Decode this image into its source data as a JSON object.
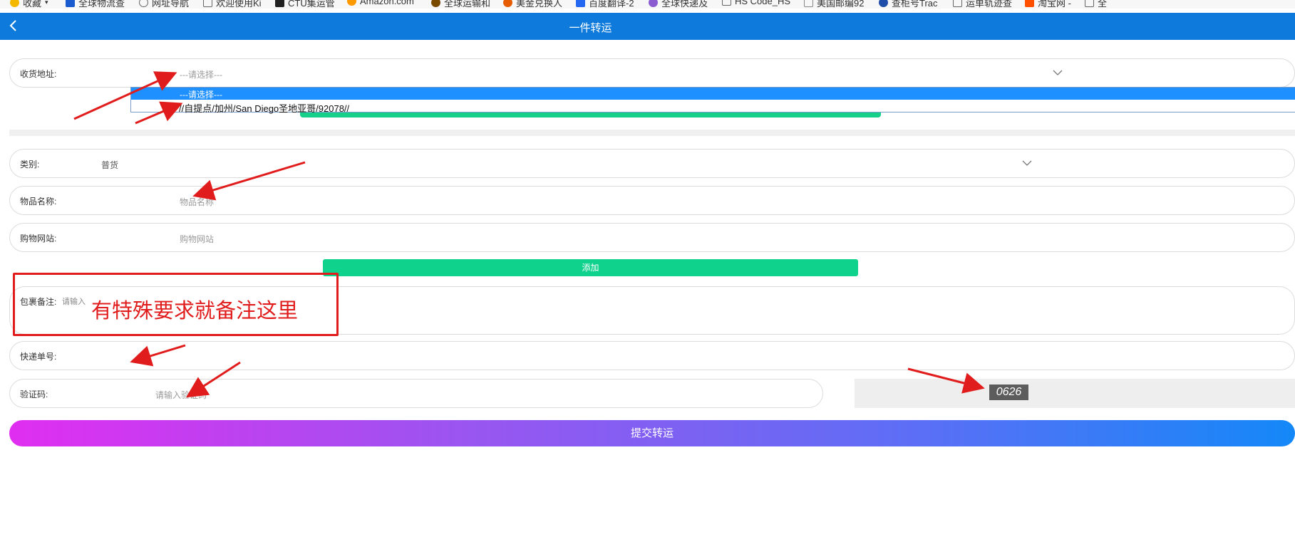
{
  "bookmarks": [
    {
      "label": "收藏",
      "color": "#f5b800"
    },
    {
      "label": "全球物流查",
      "color": "#1a5bd0"
    },
    {
      "label": "网址导航",
      "color": "#666666"
    },
    {
      "label": "欢迎使用Ki",
      "color": "#666666"
    },
    {
      "label": "CTU集运管",
      "color": "#222222"
    },
    {
      "label": "Amazon.com",
      "color": "#ff9900"
    },
    {
      "label": "全球运输和",
      "color": "#7a4a00"
    },
    {
      "label": "美金兑换人",
      "color": "#e65c00"
    },
    {
      "label": "百度翻译-2",
      "color": "#2468f2"
    },
    {
      "label": "全球快递及",
      "color": "#8a5cd0"
    },
    {
      "label": "HS Code_HS",
      "color": "#666666"
    },
    {
      "label": "美国邮编92",
      "color": "#888888"
    },
    {
      "label": "查柜号Trac",
      "color": "#1f4ea8"
    },
    {
      "label": "运单轨迹查",
      "color": "#666666"
    },
    {
      "label": "淘宝网 -",
      "color": "#ff5000"
    },
    {
      "label": "全",
      "color": "#666666"
    }
  ],
  "header": {
    "title": "一件转运"
  },
  "address": {
    "label": "收货地址:",
    "value": "---请选择---",
    "options": [
      "---请选择---",
      "//自提点/加州/San Diego圣地亚哥/92078//"
    ]
  },
  "category": {
    "label": "类别:",
    "value": "普货"
  },
  "item_name": {
    "label": "物品名称:",
    "placeholder": "物品名称"
  },
  "shop_site": {
    "label": "购物网站:",
    "placeholder": "购物网站"
  },
  "add_button": {
    "label": "添加"
  },
  "remark": {
    "label": "包裹备注:",
    "placeholder": "请输入"
  },
  "annotation": {
    "note": "有特殊要求就备注这里",
    "color": "#e11c1c"
  },
  "tracking": {
    "label": "快递单号:"
  },
  "captcha": {
    "label": "验证码:",
    "placeholder": "请输入验证码",
    "code": "0626"
  },
  "submit": {
    "label": "提交转运"
  },
  "colors": {
    "accent": "#0e7bdc",
    "green": "#0fd28c",
    "highlight": "#1e90ff"
  }
}
